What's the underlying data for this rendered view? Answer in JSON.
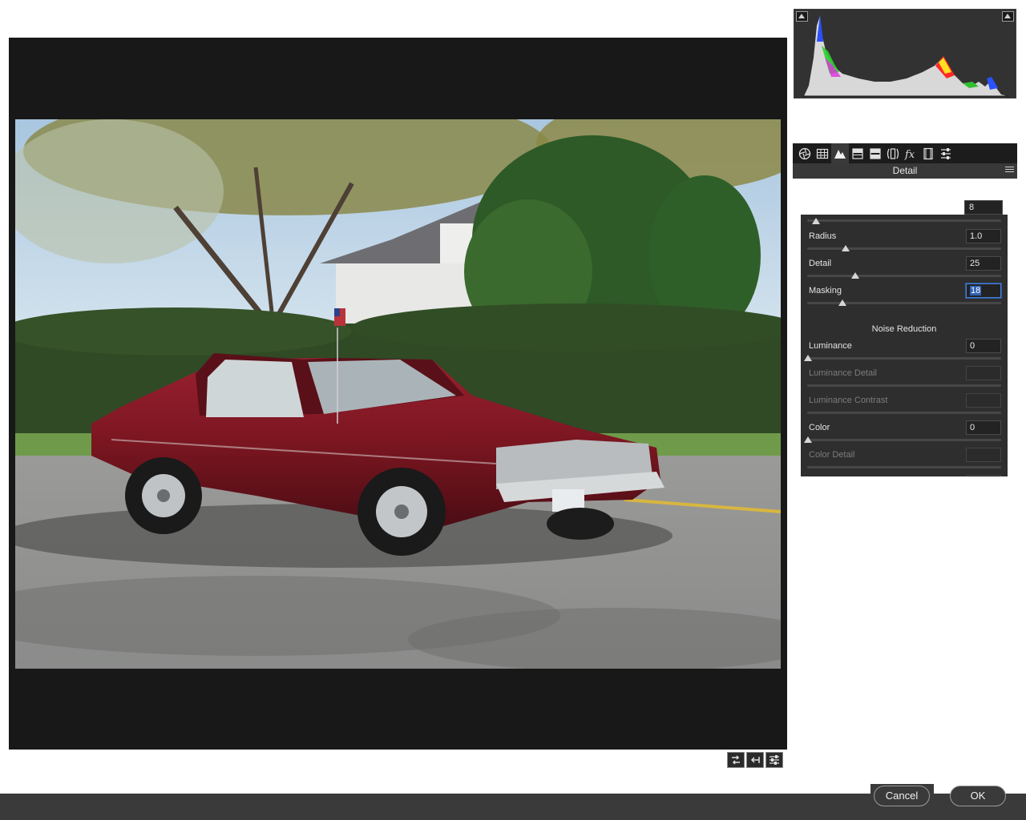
{
  "panel": {
    "title": "Detail",
    "tabs": [
      {
        "name": "aperture-icon"
      },
      {
        "name": "grid-icon"
      },
      {
        "name": "mountains-icon"
      },
      {
        "name": "split-toning-icon"
      },
      {
        "name": "hsl-icon"
      },
      {
        "name": "lens-icon"
      },
      {
        "name": "fx-icon"
      },
      {
        "name": "film-icon"
      },
      {
        "name": "sliders-icon"
      }
    ]
  },
  "sharpening": {
    "amount_value": "8",
    "radius_label": "Radius",
    "radius_value": "1.0",
    "detail_label": "Detail",
    "detail_value": "25",
    "masking_label": "Masking",
    "masking_value": "18"
  },
  "noise": {
    "heading": "Noise Reduction",
    "luminance_label": "Luminance",
    "luminance_value": "0",
    "luminance_detail_label": "Luminance Detail",
    "luminance_contrast_label": "Luminance Contrast",
    "color_label": "Color",
    "color_value": "0",
    "color_detail_label": "Color Detail"
  },
  "footer": {
    "cancel_label": "Cancel",
    "ok_label": "OK"
  },
  "colors": {
    "panel_bg": "#2e2e2e",
    "accent": "#2f62b8",
    "car": "#7a1620"
  }
}
